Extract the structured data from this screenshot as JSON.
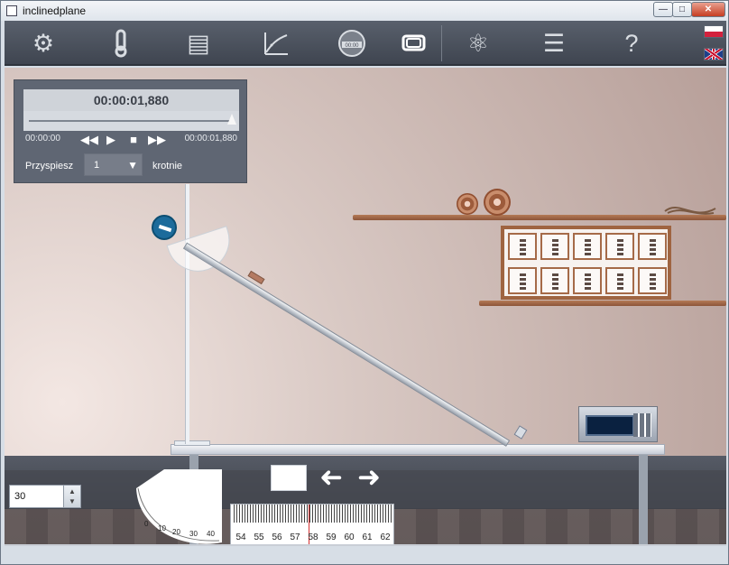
{
  "window": {
    "title": "inclinedplane",
    "minimize": "—",
    "maximize": "□",
    "close": "✕"
  },
  "toolbar": {
    "items": [
      {
        "name": "settings-icon",
        "symbol": "⚙"
      },
      {
        "name": "thermometer-icon",
        "symbol": "🌡"
      },
      {
        "name": "table-icon",
        "symbol": "▤"
      },
      {
        "name": "graph-icon",
        "symbol": "↗"
      },
      {
        "name": "timer-icon",
        "symbol": "00:00"
      },
      {
        "name": "camera-view-icon",
        "symbol": "▣"
      },
      {
        "name": "atom-icon",
        "symbol": "⚛"
      },
      {
        "name": "document-icon",
        "symbol": "☰"
      },
      {
        "name": "help-icon",
        "symbol": "?"
      }
    ]
  },
  "timer": {
    "display": "00:00:01,880",
    "start": "00:00:00",
    "end": "00:00:01,880",
    "progress": 1.0,
    "speed_label": "Przyspiesz",
    "speed_value": "1",
    "times_label": "krotnie"
  },
  "controls": {
    "angle_value": "30",
    "protractor_labels": [
      "0",
      "10",
      "20",
      "30",
      "40"
    ],
    "ruler_labels": [
      "54",
      "55",
      "56",
      "57",
      "58",
      "59",
      "60",
      "61",
      "62"
    ],
    "left_arrow": "➜",
    "right_arrow": "➜"
  }
}
